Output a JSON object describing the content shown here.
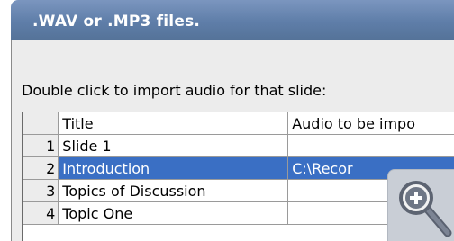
{
  "header": {
    "title": ".WAV or .MP3 files."
  },
  "instruction": "Double click to import audio for that slide:",
  "table": {
    "columns": [
      "",
      "Title",
      "Audio to be impo"
    ],
    "rows": [
      {
        "index": "1",
        "title": "Slide 1",
        "audio": ""
      },
      {
        "index": "2",
        "title": "Introduction",
        "audio": "C:\\Recor",
        "selected": true
      },
      {
        "index": "3",
        "title": "Topics of Discussion",
        "audio": ""
      },
      {
        "index": "4",
        "title": "Topic One",
        "audio": ""
      }
    ]
  },
  "colors": {
    "header": "#5f7ea9",
    "selection": "#3a6fc4",
    "panel": "#ececec"
  },
  "icons": {
    "zoom": "zoom-in-magnifier-icon"
  }
}
